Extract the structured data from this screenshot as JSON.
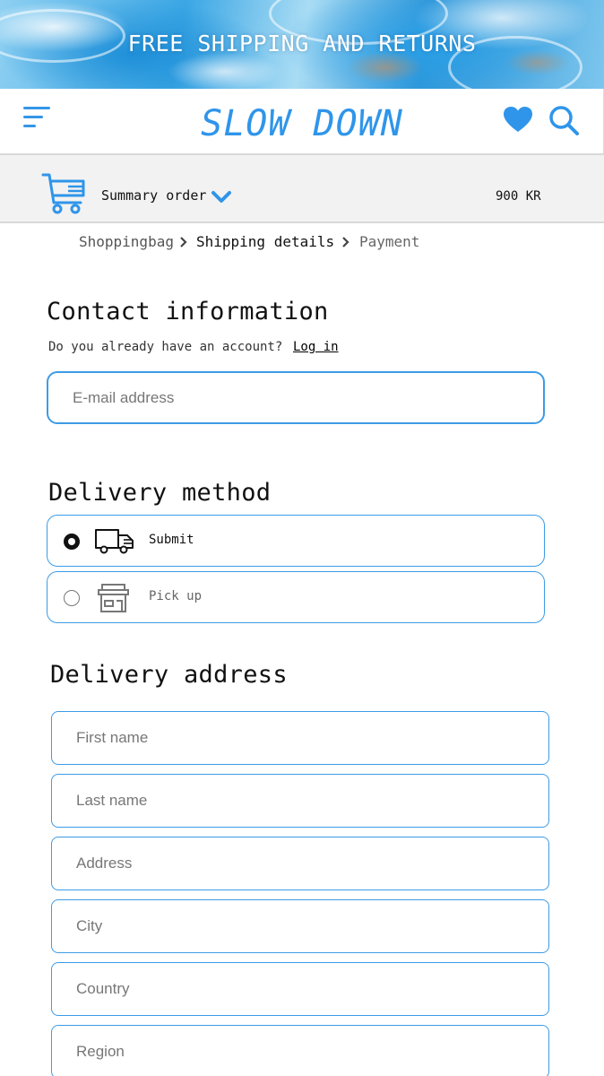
{
  "banner": {
    "text": "FREE SHIPPING AND RETURNS"
  },
  "header": {
    "logo": "SLOW DOWN",
    "menu_icon": "hamburger-menu-icon",
    "wishlist_icon": "heart-icon",
    "search_icon": "search-icon",
    "accent_color": "#2f95ea"
  },
  "summary": {
    "label": "Summary order",
    "total": "900 KR",
    "cart_icon": "shopping-cart-icon"
  },
  "breadcrumb": {
    "steps": [
      {
        "label": "Shoppingbag",
        "state": "done"
      },
      {
        "label": "Shipping details",
        "state": "current"
      },
      {
        "label": "Payment",
        "state": "upcoming"
      }
    ]
  },
  "contact": {
    "title": "Contact information",
    "account_question": "Do you already have an account?",
    "login_label": "Log in",
    "email_placeholder": "E-mail address"
  },
  "delivery_method": {
    "title": "Delivery method",
    "options": [
      {
        "label": "Submit",
        "icon": "delivery-truck-icon",
        "selected": true
      },
      {
        "label": "Pick up",
        "icon": "store-icon",
        "selected": false
      }
    ]
  },
  "delivery_address": {
    "title": "Delivery address",
    "fields": [
      {
        "placeholder": "First name"
      },
      {
        "placeholder": "Last name"
      },
      {
        "placeholder": "Address"
      },
      {
        "placeholder": "City"
      },
      {
        "placeholder": "Country"
      },
      {
        "placeholder": "Region"
      }
    ]
  }
}
